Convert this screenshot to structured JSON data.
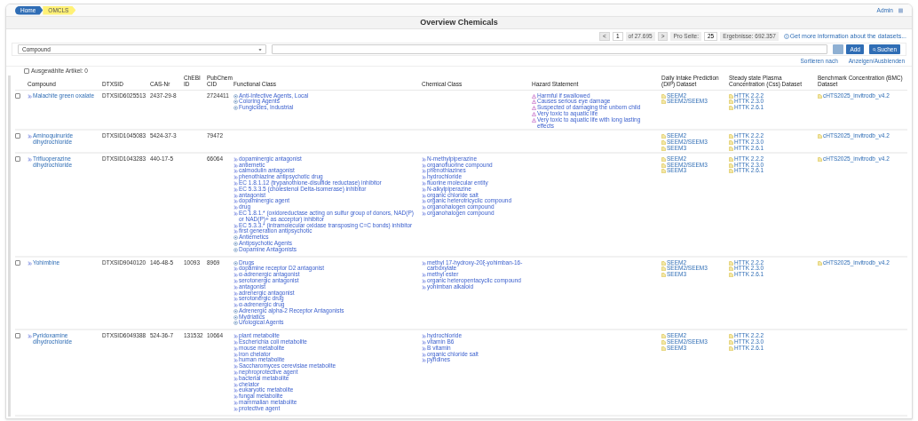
{
  "breadcrumb": [
    {
      "label": "Home",
      "selected": false
    },
    {
      "label": "OMCLS",
      "selected": true
    }
  ],
  "user_menu": "Admin",
  "title": "Overview Chemicals",
  "pagination": {
    "prev": "<",
    "page": "1",
    "of": "of 27.695",
    "next": ">",
    "per_page_label": "Pro Seite:",
    "per_page": "25",
    "results": "Ergebnisse: 692.357",
    "info_link": "Get more information about the datasets..."
  },
  "search": {
    "field_select": "Compound",
    "add_button": "Add",
    "search_button": "Suchen"
  },
  "sort_link": "Sortieren nach",
  "toggle_link": "Anzeigen/Ausblenden",
  "selected_items": {
    "label": "Ausgewählte Artikel: 0",
    "checked": false
  },
  "table": {
    "columns": [
      "Compound",
      "DTXSID",
      "CAS-Nr",
      "ChEBI ID",
      "PubChem CID",
      "Functional Class",
      "Chemical Class",
      "Hazard Statement",
      "Daily Intake Prediction (DIP) Dataset",
      "Steady state Plasma Concentration (Css) Dataset",
      "Benchmark Concentration (BMC) Dataset"
    ],
    "rows": [
      {
        "checked": false,
        "compound": "Malachite green oxalate",
        "dtxsid": "DTXSID6025513",
        "cas": "2437-29-8",
        "chebi": "",
        "pubchem": "2724411",
        "functional_class": [
          {
            "kind": "mesh",
            "label": "Anti-Infective Agents, Local"
          },
          {
            "kind": "mesh",
            "label": "Coloring Agents"
          },
          {
            "kind": "mesh",
            "label": "Fungicides, Industrial"
          }
        ],
        "chemical_class": [],
        "hazard": [
          "Harmful if swallowed",
          "Causes serious eye damage",
          "Suspected of damaging the unborn child",
          "Very toxic to aquatic life",
          "Very toxic to aquatic life with long lasting effects"
        ],
        "dip": [
          "SEEM2",
          "SEEM2/SEEM3"
        ],
        "css": [
          "HTTK 2.2.2",
          "HTTK 2.3.0",
          "HTTK 2.6.1"
        ],
        "bmc": [
          "cHTS2025_invitrodb_v4.2"
        ]
      },
      {
        "checked": false,
        "compound": "Aminoquinuride dihydrochloride",
        "dtxsid": "DTXSID1045083",
        "cas": "5424-37-3",
        "chebi": "",
        "pubchem": "79472",
        "functional_class": [],
        "chemical_class": [],
        "hazard": [],
        "dip": [
          "SEEM2",
          "SEEM2/SEEM3",
          "SEEM3"
        ],
        "css": [
          "HTTK 2.2.2",
          "HTTK 2.3.0",
          "HTTK 2.6.1"
        ],
        "bmc": [
          "cHTS2025_invitrodb_v4.2"
        ]
      },
      {
        "checked": false,
        "compound": "Trifluoperazine dihydrochloride",
        "dtxsid": "DTXSID1043283",
        "cas": "440-17-5",
        "chebi": "",
        "pubchem": "66064",
        "functional_class": [
          {
            "kind": "chebi",
            "label": "dopaminergic antagonist"
          },
          {
            "kind": "chebi",
            "label": "antiemetic"
          },
          {
            "kind": "chebi",
            "label": "calmodulin antagonist"
          },
          {
            "kind": "chebi",
            "label": "phenothiazine antipsychotic drug"
          },
          {
            "kind": "chebi",
            "label": "EC 1.8.1.12 (trypanothione-disulfide reductase) inhibitor"
          },
          {
            "kind": "chebi",
            "label": "EC 5.3.3.5 (cholestenol Delta-isomerase) inhibitor"
          },
          {
            "kind": "chebi",
            "label": "antagonist"
          },
          {
            "kind": "chebi",
            "label": "dopaminergic agent"
          },
          {
            "kind": "chebi",
            "label": "drug"
          },
          {
            "kind": "chebi",
            "label": "EC 1.8.1.* (oxidoreductase acting on sulfur group of donors, NAD(P) or NAD(P)+ as acceptor) inhibitor"
          },
          {
            "kind": "chebi",
            "label": "EC 5.3.3.* (intramolecular oxidase transposing C=C bonds) inhibitor"
          },
          {
            "kind": "chebi",
            "label": "first generation antipsychotic"
          },
          {
            "kind": "mesh",
            "label": "Antiemetics"
          },
          {
            "kind": "mesh",
            "label": "Antipsychotic Agents"
          },
          {
            "kind": "mesh",
            "label": "Dopamine Antagonists"
          }
        ],
        "chemical_class": [
          "N-methylpiperazine",
          "organofluorine compound",
          "phenothiazines",
          "hydrochloride",
          "fluorine molecular entity",
          "N-alkylpiperazine",
          "organic chloride salt",
          "organic heterotricyclic compound",
          "organohalogen compound",
          "organohalogen compound"
        ],
        "hazard": [],
        "dip": [
          "SEEM2",
          "SEEM2/SEEM3",
          "SEEM3"
        ],
        "css": [
          "HTTK 2.2.2",
          "HTTK 2.3.0",
          "HTTK 2.6.1"
        ],
        "bmc": [
          "cHTS2025_invitrodb_v4.2"
        ]
      },
      {
        "checked": false,
        "compound": "Yohimbine",
        "dtxsid": "DTXSID9040120",
        "cas": "146-48-5",
        "chebi": "10093",
        "pubchem": "8969",
        "functional_class": [
          {
            "kind": "mesh",
            "label": "Drugs"
          },
          {
            "kind": "chebi",
            "label": "dopamine receptor D2 antagonist"
          },
          {
            "kind": "chebi",
            "label": "α-adrenergic antagonist"
          },
          {
            "kind": "chebi",
            "label": "serotonergic antagonist"
          },
          {
            "kind": "chebi",
            "label": "antagonist"
          },
          {
            "kind": "chebi",
            "label": "adrenergic antagonist"
          },
          {
            "kind": "chebi",
            "label": "serotonergic drug"
          },
          {
            "kind": "chebi",
            "label": "α-adrenergic drug"
          },
          {
            "kind": "mesh",
            "label": "Adrenergic alpha-2 Receptor Antagonists"
          },
          {
            "kind": "mesh",
            "label": "Mydriatics"
          },
          {
            "kind": "mesh",
            "label": "Urological Agents"
          }
        ],
        "chemical_class": [
          "methyl 17-hydroxy-20ξ-yohimban-16-carboxylate",
          "methyl ester",
          "organic heteropentacyclic compound",
          "yohimban alkaloid"
        ],
        "hazard": [],
        "dip": [
          "SEEM2",
          "SEEM2/SEEM3",
          "SEEM3"
        ],
        "css": [
          "HTTK 2.2.2",
          "HTTK 2.3.0",
          "HTTK 2.6.1"
        ],
        "bmc": [
          "cHTS2025_invitrodb_v4.2"
        ]
      },
      {
        "checked": false,
        "compound": "Pyridoxamine dihydrochloride",
        "dtxsid": "DTXSID6049388",
        "cas": "524-36-7",
        "chebi": "131532",
        "pubchem": "10664",
        "functional_class": [
          {
            "kind": "chebi",
            "label": "plant metabolite"
          },
          {
            "kind": "chebi",
            "label": "Escherichia coli metabolite"
          },
          {
            "kind": "chebi",
            "label": "mouse metabolite"
          },
          {
            "kind": "chebi",
            "label": "iron chelator"
          },
          {
            "kind": "chebi",
            "label": "human metabolite"
          },
          {
            "kind": "chebi",
            "label": "Saccharomyces cerevisiae metabolite"
          },
          {
            "kind": "chebi",
            "label": "nephroprotective agent"
          },
          {
            "kind": "chebi",
            "label": "bacterial metabolite"
          },
          {
            "kind": "chebi",
            "label": "chelator"
          },
          {
            "kind": "chebi",
            "label": "eukaryotic metabolite"
          },
          {
            "kind": "chebi",
            "label": "fungal metabolite"
          },
          {
            "kind": "chebi",
            "label": "mammalian metabolite"
          },
          {
            "kind": "chebi",
            "label": "protective agent"
          }
        ],
        "chemical_class": [
          "hydrochloride",
          "vitamin B6",
          "B vitamin",
          "organic chloride salt",
          "pyridines"
        ],
        "hazard": [],
        "dip": [
          "SEEM2",
          "SEEM2/SEEM3",
          "SEEM3"
        ],
        "css": [
          "HTTK 2.2.2",
          "HTTK 2.3.0",
          "HTTK 2.6.1"
        ],
        "bmc": []
      }
    ]
  }
}
